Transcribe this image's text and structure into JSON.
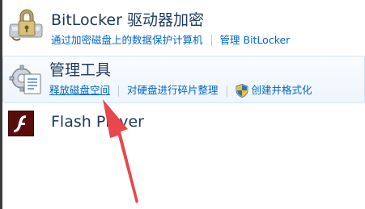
{
  "items": [
    {
      "title": "BitLocker 驱动器加密",
      "links": [
        "通过加密磁盘上的数据保护计算机",
        "管理 BitLocker"
      ],
      "icon": "bitlocker-drive-icon"
    },
    {
      "title": "管理工具",
      "links": [
        "释放磁盘空间",
        "对硬盘进行碎片整理",
        "创建并格式化"
      ],
      "icon": "admin-tools-icon",
      "shield_icon": "uac-shield-icon"
    },
    {
      "title": "Flash Player",
      "icon": "flash-player-icon"
    }
  ],
  "annotation": {
    "arrow_color": "#e8474c"
  }
}
